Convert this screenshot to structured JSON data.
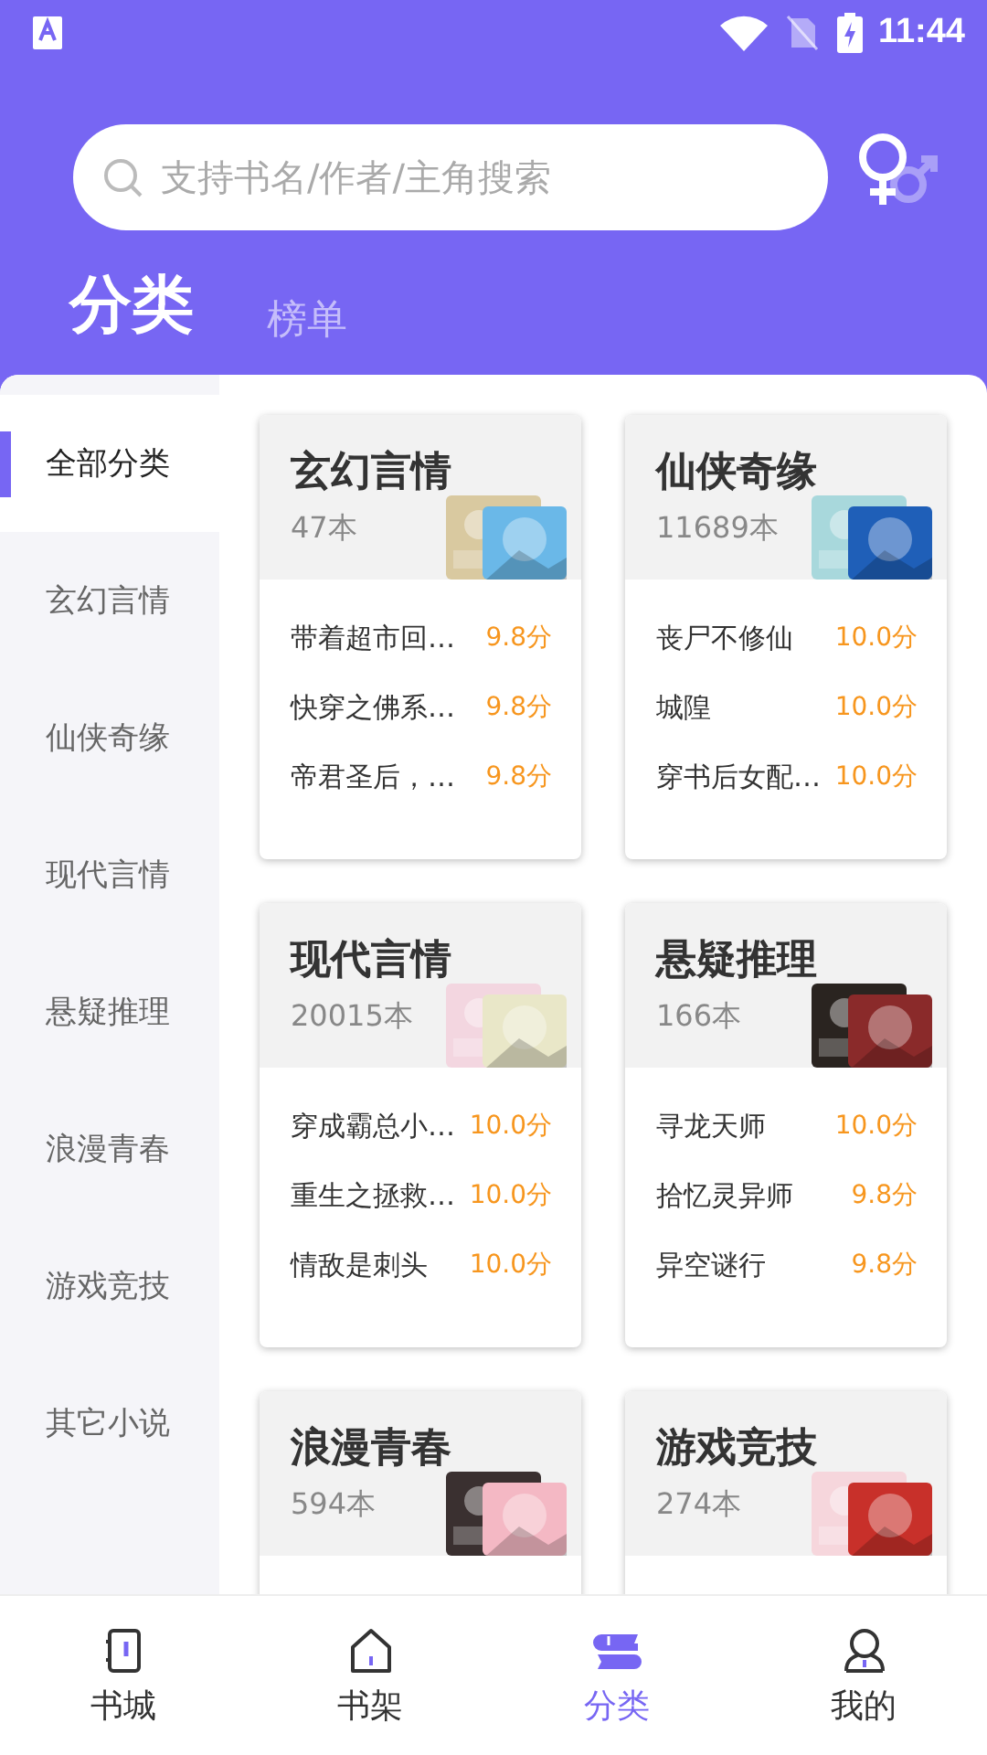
{
  "status_bar": {
    "time": "11:44"
  },
  "search": {
    "placeholder": "支持书名/作者/主角搜索"
  },
  "tabs": [
    {
      "label": "分类",
      "selected": true
    },
    {
      "label": "榜单",
      "selected": false
    }
  ],
  "sidebar": {
    "items": [
      {
        "label": "全部分类",
        "selected": true
      },
      {
        "label": "玄幻言情",
        "selected": false
      },
      {
        "label": "仙侠奇缘",
        "selected": false
      },
      {
        "label": "现代言情",
        "selected": false
      },
      {
        "label": "悬疑推理",
        "selected": false
      },
      {
        "label": "浪漫青春",
        "selected": false
      },
      {
        "label": "游戏竞技",
        "selected": false
      },
      {
        "label": "其它小说",
        "selected": false
      }
    ]
  },
  "categories": [
    {
      "title": "玄幻言情",
      "count": "47本",
      "books": [
        {
          "name": "带着超市回…",
          "score": "9.8分"
        },
        {
          "name": "快穿之佛系…",
          "score": "9.8分"
        },
        {
          "name": "帝君圣后，…",
          "score": "9.8分"
        }
      ]
    },
    {
      "title": "仙侠奇缘",
      "count": "11689本",
      "books": [
        {
          "name": "丧尸不修仙",
          "score": "10.0分"
        },
        {
          "name": "城隍",
          "score": "10.0分"
        },
        {
          "name": "穿书后女配…",
          "score": "10.0分"
        }
      ]
    },
    {
      "title": "现代言情",
      "count": "20015本",
      "books": [
        {
          "name": "穿成霸总小…",
          "score": "10.0分"
        },
        {
          "name": "重生之拯救…",
          "score": "10.0分"
        },
        {
          "name": "情敌是刺头",
          "score": "10.0分"
        }
      ]
    },
    {
      "title": "悬疑推理",
      "count": "166本",
      "books": [
        {
          "name": "寻龙天师",
          "score": "10.0分"
        },
        {
          "name": "拾忆灵异师",
          "score": "9.8分"
        },
        {
          "name": "异空谜行",
          "score": "9.8分"
        }
      ]
    },
    {
      "title": "浪漫青春",
      "count": "594本"
    },
    {
      "title": "游戏竞技",
      "count": "274本"
    }
  ],
  "bottom_nav": [
    {
      "label": "书城",
      "selected": false
    },
    {
      "label": "书架",
      "selected": false
    },
    {
      "label": "分类",
      "selected": true
    },
    {
      "label": "我的",
      "selected": false
    }
  ]
}
